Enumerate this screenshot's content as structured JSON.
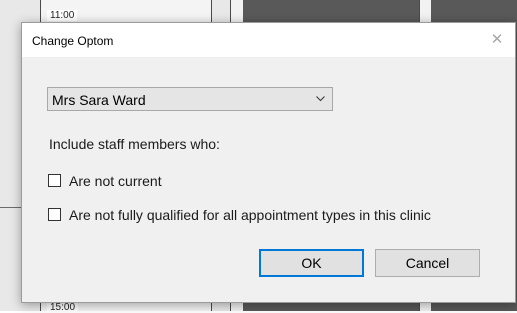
{
  "background": {
    "time_top": "11:00",
    "time_bottom": "15:00"
  },
  "dialog": {
    "title": "Change Optom",
    "close_icon": "close-icon",
    "staff_select": {
      "selected": "Mrs Sara Ward",
      "icon": "chevron-down-icon"
    },
    "include_label": "Include staff members who:",
    "checkboxes": [
      {
        "label": "Are not current",
        "checked": false
      },
      {
        "label": "Are not fully qualified for all appointment types in this clinic",
        "checked": false
      }
    ],
    "buttons": {
      "ok": "OK",
      "cancel": "Cancel"
    }
  },
  "colors": {
    "focus_border": "#0078d7",
    "button_bg": "#e1e1e1",
    "dialog_bg": "#f0f0f0"
  }
}
